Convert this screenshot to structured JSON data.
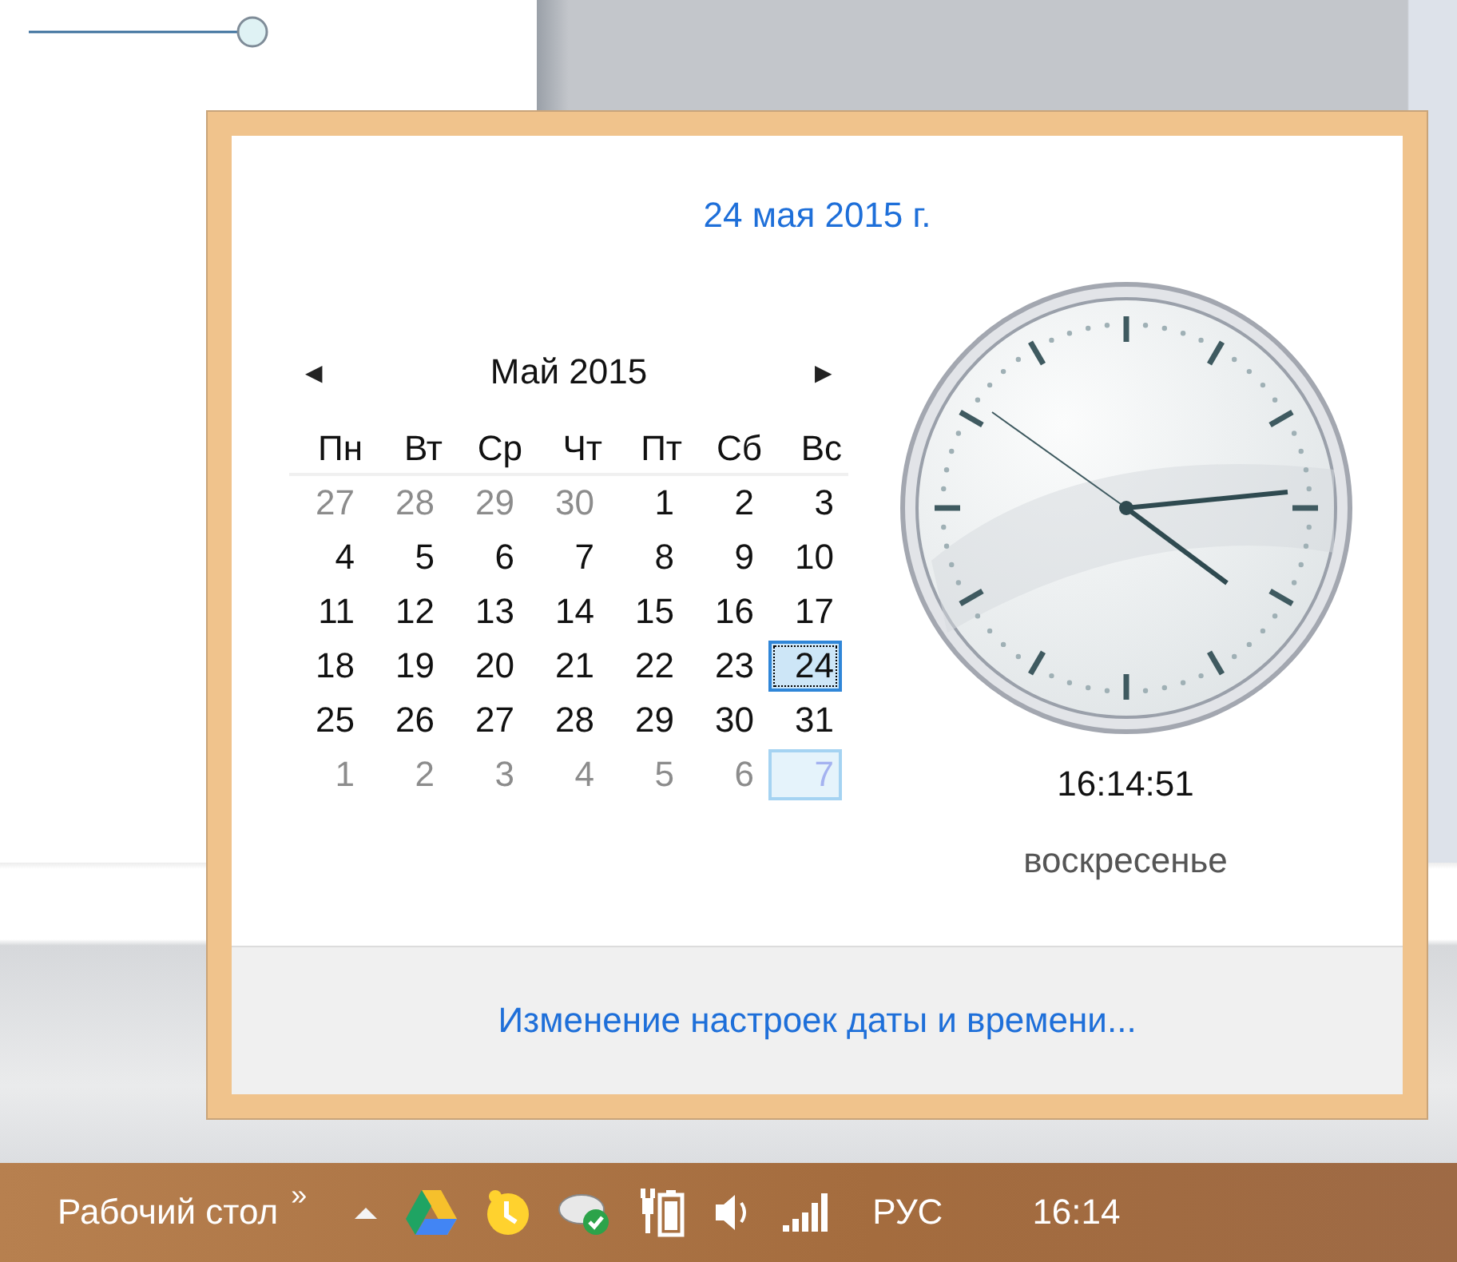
{
  "zoom_slider": {
    "level": 1
  },
  "flyout": {
    "date_link": "24 мая 2015 г.",
    "calendar": {
      "prev": "◀",
      "month": "Май 2015",
      "next": "▶",
      "weekdays": [
        "Пн",
        "Вт",
        "Ср",
        "Чт",
        "Пт",
        "Сб",
        "Вс"
      ],
      "weeks": [
        [
          {
            "day": "27",
            "other": true,
            "selected": false,
            "highlighted": false
          },
          {
            "day": "28",
            "other": true,
            "selected": false,
            "highlighted": false
          },
          {
            "day": "29",
            "other": true,
            "selected": false,
            "highlighted": false
          },
          {
            "day": "30",
            "other": true,
            "selected": false,
            "highlighted": false
          },
          {
            "day": "1",
            "other": false,
            "selected": false,
            "highlighted": false
          },
          {
            "day": "2",
            "other": false,
            "selected": false,
            "highlighted": false
          },
          {
            "day": "3",
            "other": false,
            "selected": false,
            "highlighted": false
          }
        ],
        [
          {
            "day": "4",
            "other": false,
            "selected": false,
            "highlighted": false
          },
          {
            "day": "5",
            "other": false,
            "selected": false,
            "highlighted": false
          },
          {
            "day": "6",
            "other": false,
            "selected": false,
            "highlighted": false
          },
          {
            "day": "7",
            "other": false,
            "selected": false,
            "highlighted": false
          },
          {
            "day": "8",
            "other": false,
            "selected": false,
            "highlighted": false
          },
          {
            "day": "9",
            "other": false,
            "selected": false,
            "highlighted": false
          },
          {
            "day": "10",
            "other": false,
            "selected": false,
            "highlighted": false
          }
        ],
        [
          {
            "day": "11",
            "other": false,
            "selected": false,
            "highlighted": false
          },
          {
            "day": "12",
            "other": false,
            "selected": false,
            "highlighted": false
          },
          {
            "day": "13",
            "other": false,
            "selected": false,
            "highlighted": false
          },
          {
            "day": "14",
            "other": false,
            "selected": false,
            "highlighted": false
          },
          {
            "day": "15",
            "other": false,
            "selected": false,
            "highlighted": false
          },
          {
            "day": "16",
            "other": false,
            "selected": false,
            "highlighted": false
          },
          {
            "day": "17",
            "other": false,
            "selected": false,
            "highlighted": false
          }
        ],
        [
          {
            "day": "18",
            "other": false,
            "selected": false,
            "highlighted": false
          },
          {
            "day": "19",
            "other": false,
            "selected": false,
            "highlighted": false
          },
          {
            "day": "20",
            "other": false,
            "selected": false,
            "highlighted": false
          },
          {
            "day": "21",
            "other": false,
            "selected": false,
            "highlighted": false
          },
          {
            "day": "22",
            "other": false,
            "selected": false,
            "highlighted": false
          },
          {
            "day": "23",
            "other": false,
            "selected": false,
            "highlighted": false
          },
          {
            "day": "24",
            "other": false,
            "selected": true,
            "highlighted": false
          }
        ],
        [
          {
            "day": "25",
            "other": false,
            "selected": false,
            "highlighted": false
          },
          {
            "day": "26",
            "other": false,
            "selected": false,
            "highlighted": false
          },
          {
            "day": "27",
            "other": false,
            "selected": false,
            "highlighted": false
          },
          {
            "day": "28",
            "other": false,
            "selected": false,
            "highlighted": false
          },
          {
            "day": "29",
            "other": false,
            "selected": false,
            "highlighted": false
          },
          {
            "day": "30",
            "other": false,
            "selected": false,
            "highlighted": false
          },
          {
            "day": "31",
            "other": false,
            "selected": false,
            "highlighted": false
          }
        ],
        [
          {
            "day": "1",
            "other": true,
            "selected": false,
            "highlighted": false
          },
          {
            "day": "2",
            "other": true,
            "selected": false,
            "highlighted": false
          },
          {
            "day": "3",
            "other": true,
            "selected": false,
            "highlighted": false
          },
          {
            "day": "4",
            "other": true,
            "selected": false,
            "highlighted": false
          },
          {
            "day": "5",
            "other": true,
            "selected": false,
            "highlighted": false
          },
          {
            "day": "6",
            "other": true,
            "selected": false,
            "highlighted": false
          },
          {
            "day": "7",
            "other": true,
            "selected": false,
            "highlighted": true
          }
        ]
      ]
    },
    "time": "16:14:51",
    "weekday": "воскресенье",
    "settings_link": "Изменение настроек даты и времени..."
  },
  "taskbar": {
    "toolbar": "Рабочий стол",
    "chevron": "»",
    "language": "РУС",
    "clock": "16:14"
  }
}
